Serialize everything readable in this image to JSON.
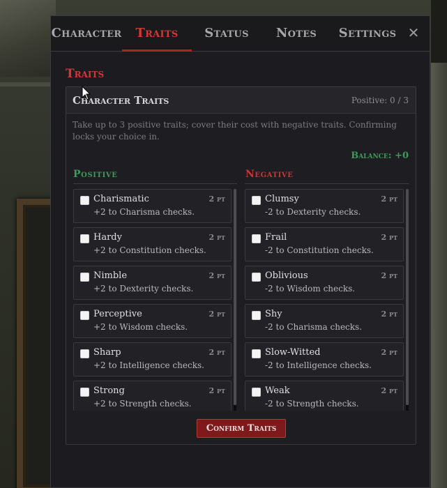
{
  "tabs": [
    {
      "label": "Character"
    },
    {
      "label": "Traits"
    },
    {
      "label": "Status"
    },
    {
      "label": "Notes"
    },
    {
      "label": "Settings"
    }
  ],
  "close_icon": "close-icon",
  "section_title": "Traits",
  "card": {
    "title": "Character Traits",
    "counter": "Positive: 0 / 3",
    "description": "Take up to 3 positive traits; cover their cost with negative traits. Confirming locks your choice in.",
    "balance": "Balance: +0"
  },
  "positive": {
    "heading": "Positive",
    "traits": [
      {
        "name": "Charismatic",
        "points": "2 pt",
        "effect": "+2 to Charisma checks."
      },
      {
        "name": "Hardy",
        "points": "2 pt",
        "effect": "+2 to Constitution checks."
      },
      {
        "name": "Nimble",
        "points": "2 pt",
        "effect": "+2 to Dexterity checks."
      },
      {
        "name": "Perceptive",
        "points": "2 pt",
        "effect": "+2 to Wisdom checks."
      },
      {
        "name": "Sharp",
        "points": "2 pt",
        "effect": "+2 to Intelligence checks."
      },
      {
        "name": "Strong",
        "points": "2 pt",
        "effect": "+2 to Strength checks."
      }
    ]
  },
  "negative": {
    "heading": "Negative",
    "traits": [
      {
        "name": "Clumsy",
        "points": "2 pt",
        "effect": "-2 to Dexterity checks."
      },
      {
        "name": "Frail",
        "points": "2 pt",
        "effect": "-2 to Constitution checks."
      },
      {
        "name": "Oblivious",
        "points": "2 pt",
        "effect": "-2 to Wisdom checks."
      },
      {
        "name": "Shy",
        "points": "2 pt",
        "effect": "-2 to Charisma checks."
      },
      {
        "name": "Slow-Witted",
        "points": "2 pt",
        "effect": "-2 to Intelligence checks."
      },
      {
        "name": "Weak",
        "points": "2 pt",
        "effect": "-2 to Strength checks."
      }
    ]
  },
  "confirm_label": "Confirm Traits",
  "colors": {
    "accent": "#cf3a36",
    "positive": "#3f9a5b",
    "negative": "#c2373a",
    "button": "#7e1a1b"
  }
}
